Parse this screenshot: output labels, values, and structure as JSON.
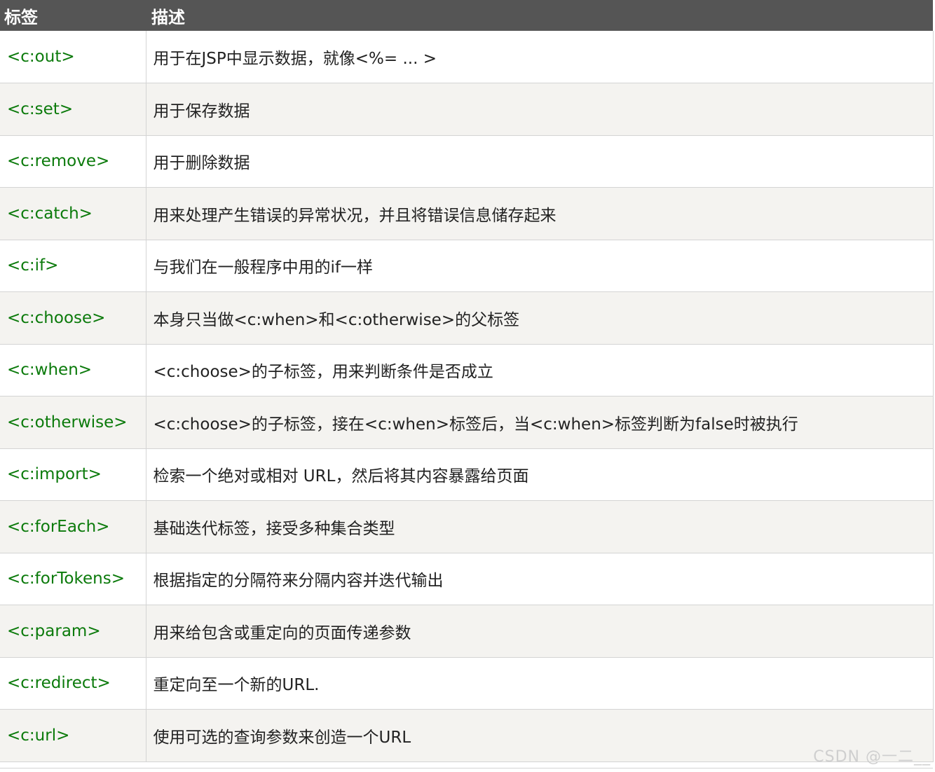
{
  "table": {
    "headers": [
      "标签",
      "描述"
    ],
    "rows": [
      {
        "tag": "<c:out>",
        "desc": "用于在JSP中显示数据，就像<%= ... >"
      },
      {
        "tag": "<c:set>",
        "desc": "用于保存数据"
      },
      {
        "tag": "<c:remove>",
        "desc": "用于删除数据"
      },
      {
        "tag": "<c:catch>",
        "desc": "用来处理产生错误的异常状况，并且将错误信息储存起来"
      },
      {
        "tag": "<c:if>",
        "desc": "与我们在一般程序中用的if一样"
      },
      {
        "tag": "<c:choose>",
        "desc": "本身只当做<c:when>和<c:otherwise>的父标签"
      },
      {
        "tag": "<c:when>",
        "desc": "<c:choose>的子标签，用来判断条件是否成立"
      },
      {
        "tag": "<c:otherwise>",
        "desc": "<c:choose>的子标签，接在<c:when>标签后，当<c:when>标签判断为false时被执行"
      },
      {
        "tag": "<c:import>",
        "desc": "检索一个绝对或相对 URL，然后将其内容暴露给页面"
      },
      {
        "tag": "<c:forEach>",
        "desc": "基础迭代标签，接受多种集合类型"
      },
      {
        "tag": "<c:forTokens>",
        "desc": "根据指定的分隔符来分隔内容并迭代输出"
      },
      {
        "tag": "<c:param>",
        "desc": "用来给包含或重定向的页面传递参数"
      },
      {
        "tag": "<c:redirect>",
        "desc": "重定向至一个新的URL."
      },
      {
        "tag": "<c:url>",
        "desc": "使用可选的查询参数来创造一个URL"
      }
    ]
  },
  "watermark": "CSDN @一二__",
  "colors": {
    "header_bg": "#555555",
    "tag_text": "#0b7a0b",
    "alt_row_bg": "#f4f3f0"
  }
}
